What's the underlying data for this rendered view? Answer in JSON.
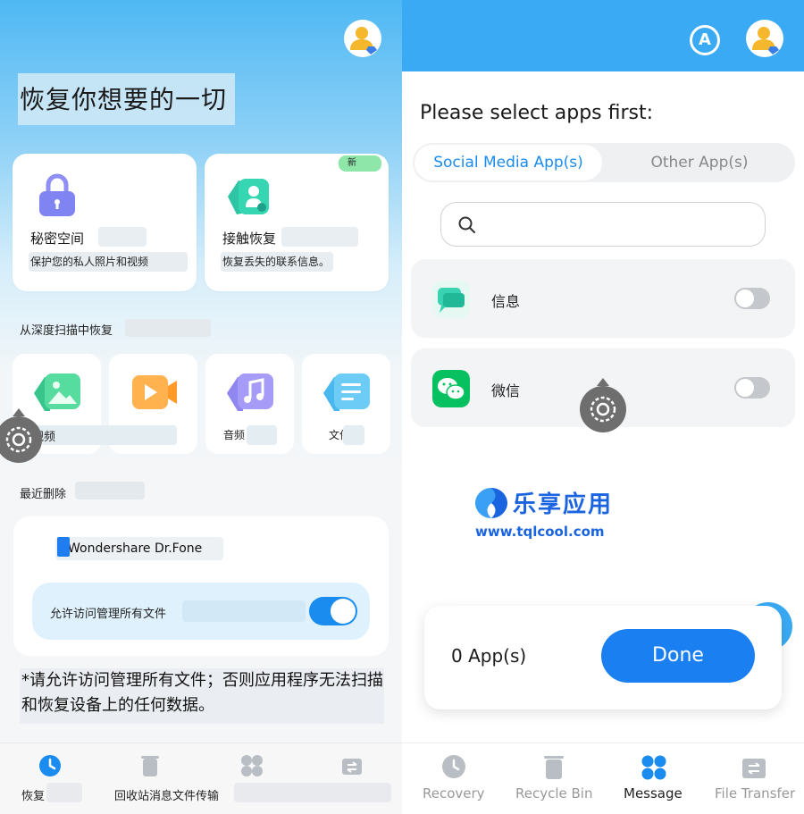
{
  "left": {
    "hero_title": "恢复你想要的一切",
    "cards": [
      {
        "title": "秘密空间",
        "desc": "保护您的私人照片和视频"
      },
      {
        "title": "接触恢复",
        "desc": "恢复丢失的联系信息。",
        "badge": "新"
      }
    ],
    "deep_scan_label": "从深度扫描中恢复",
    "media": [
      {
        "label": "视频",
        "icon": "image-icon"
      },
      {
        "label": "",
        "icon": "video-icon"
      },
      {
        "label": "音频",
        "icon": "music-icon"
      },
      {
        "label": "文件",
        "icon": "document-icon"
      }
    ],
    "recent_label": "最近删除",
    "recent_app": "Wondershare Dr.Fone",
    "permission_label": "允许访问管理所有文件",
    "permission_enabled": true,
    "warning": "*请允许访问管理所有文件；否则应用程序无法扫描和恢复设备上的任何数据。",
    "nav": [
      {
        "label": "恢复",
        "active": true
      },
      {
        "label": "回收站消息文件传输",
        "active": false
      }
    ]
  },
  "right": {
    "select_title": "Please select apps first:",
    "tabs": {
      "social": "Social Media App(s)",
      "other": "Other App(s)"
    },
    "search_placeholder": "",
    "apps": [
      {
        "name": "信息",
        "enabled": false,
        "icon": "messages-icon"
      },
      {
        "name": "微信",
        "enabled": false,
        "icon": "wechat-icon"
      }
    ],
    "watermark": {
      "title": "乐享应用",
      "url": "www.tqlcool.com"
    },
    "count": "0 App(s)",
    "done": "Done",
    "nav": [
      {
        "label": "Recovery",
        "active": false
      },
      {
        "label": "Recycle Bin",
        "active": false
      },
      {
        "label": "Message",
        "active": true
      },
      {
        "label": "File Transfer",
        "active": false
      }
    ]
  },
  "colors": {
    "accent": "#1a7ff0",
    "header": "#3aaaf5",
    "badge": "#8ee6a8",
    "wechat": "#07c160"
  }
}
